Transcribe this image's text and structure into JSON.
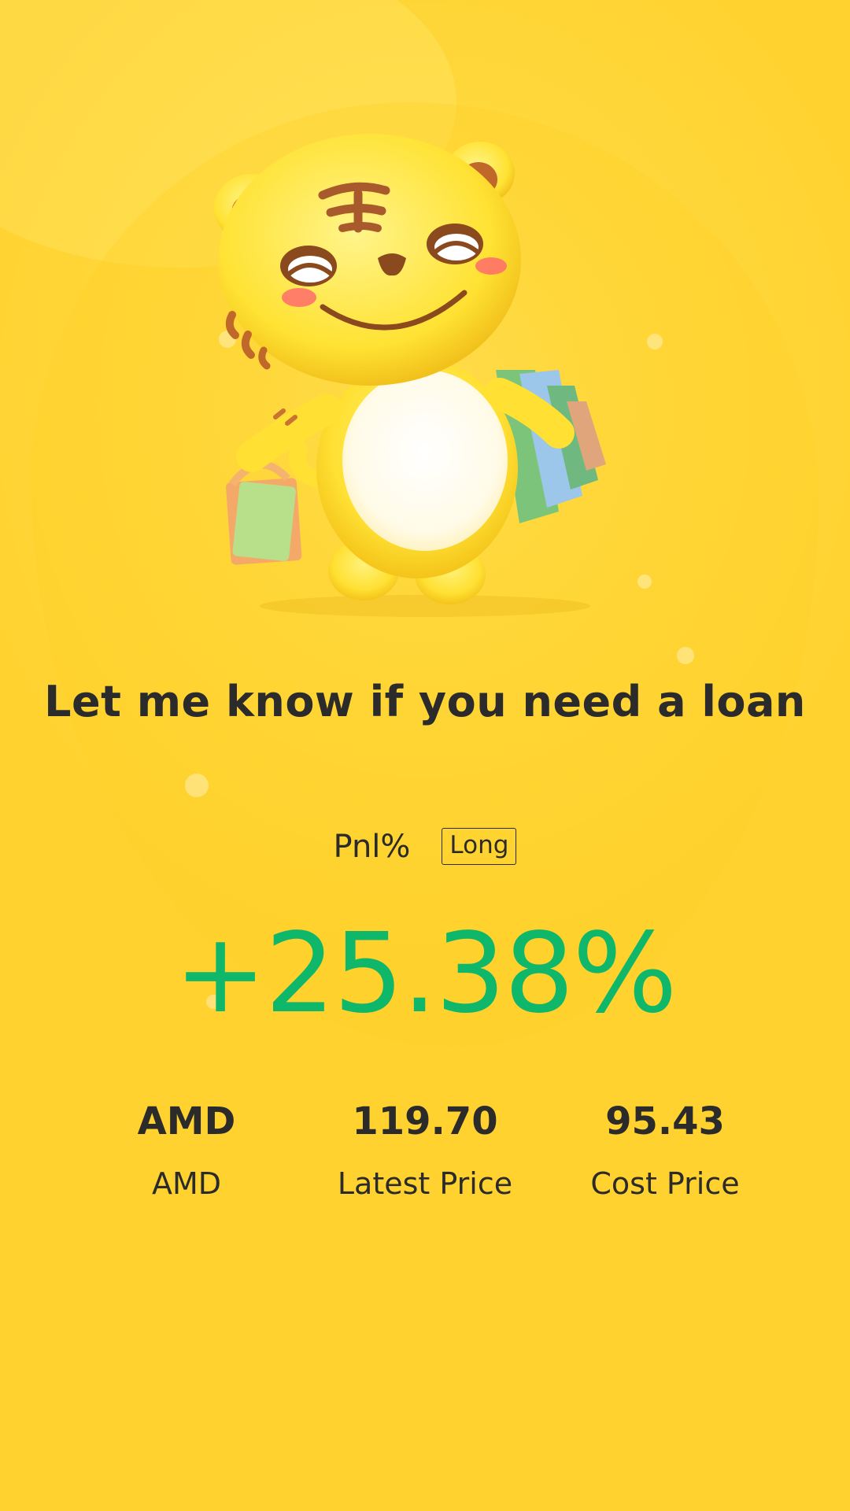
{
  "headline": "Let me know if you need a loan",
  "pnl": {
    "label": "Pnl%",
    "direction": "Long",
    "value": "+25.38%",
    "value_color": "#0fb76a"
  },
  "stats": {
    "symbol": {
      "value": "AMD",
      "label": "AMD"
    },
    "latest_price": {
      "value": "119.70",
      "label": "Latest Price"
    },
    "cost_price": {
      "value": "95.43",
      "label": "Cost Price"
    }
  },
  "colors": {
    "background": "#ffd93f",
    "text": "#2b2b2b",
    "positive": "#0fb76a"
  },
  "illustration": {
    "name": "tiger-mascot-with-shopping-bags"
  }
}
